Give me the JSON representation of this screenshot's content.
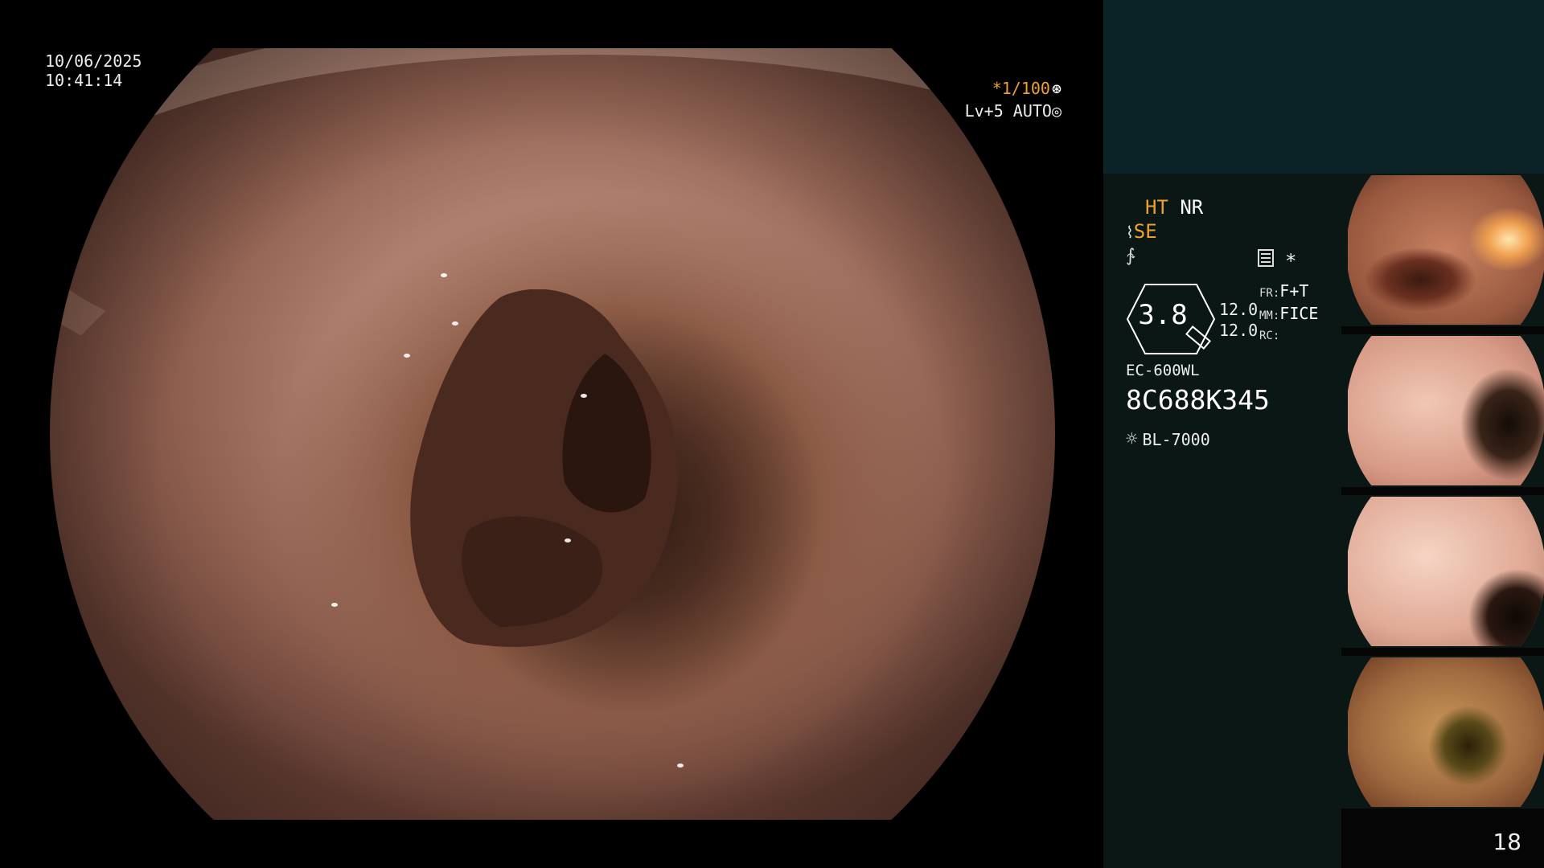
{
  "overlay": {
    "date": "10/06/2025",
    "time": "10:41:14",
    "shutter": "*1/100",
    "level": "Lv+5 AUTO"
  },
  "panel": {
    "ht": "HT",
    "nr": "NR",
    "se": "SE",
    "zoom_value": "3.8",
    "val1": "12.0",
    "val2": "12.0",
    "fr_label": "FR:",
    "fr_value": "F+T",
    "mm_label": "MM:",
    "mm_value": "FICE",
    "rc_label": "RC:",
    "scope_model": "EC-600WL",
    "serial": "8C688K345",
    "light_source": "BL-7000"
  },
  "page_number": "18",
  "colors": {
    "accent_orange": "#f0a030",
    "panel_top_bg": "#0b2226",
    "panel_info_bg": "#0a1715"
  },
  "icons": [
    "shutter-wheel-icon",
    "auto-iris-icon",
    "structure-enhance-icon",
    "color-enhance-icon",
    "menu-icon",
    "asterisk-icon",
    "magnifier-icon",
    "light-source-icon"
  ]
}
